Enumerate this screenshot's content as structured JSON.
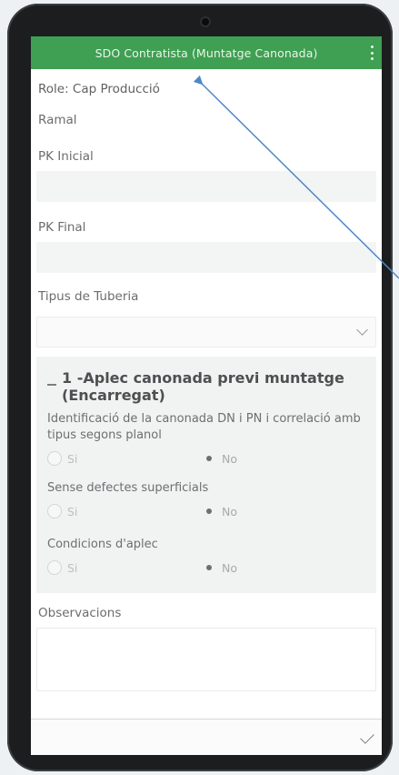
{
  "header": {
    "title": "SDO Contratista (Muntatge Canonada)",
    "menu_icon": "kebab-icon"
  },
  "form": {
    "role": "Role: Cap Producció",
    "ramal_label": "Ramal",
    "pk_inicial_label": "PK Inicial",
    "pk_inicial_value": "",
    "pk_final_label": "PK Final",
    "pk_final_value": "",
    "tipus_label": "Tipus de Tuberia",
    "tipus_value": ""
  },
  "section": {
    "number": "1",
    "title_main": "-Aplec canonada previ muntatge",
    "title_sub": "(Encarregat)",
    "questions": [
      {
        "text": "Identificació de la canonada DN i PN i correlació amb tipus segons planol",
        "yes": "Si",
        "no": "No",
        "selected": "No"
      },
      {
        "text": "Sense defectes superficials",
        "yes": "Si",
        "no": "No",
        "selected": "No"
      },
      {
        "text": "Condicions d'aplec",
        "yes": "Si",
        "no": "No",
        "selected": "No"
      }
    ]
  },
  "observations": {
    "label": "Observacions",
    "value": ""
  },
  "colors": {
    "header": "#3f9f52",
    "arrow": "#4d88c9"
  }
}
